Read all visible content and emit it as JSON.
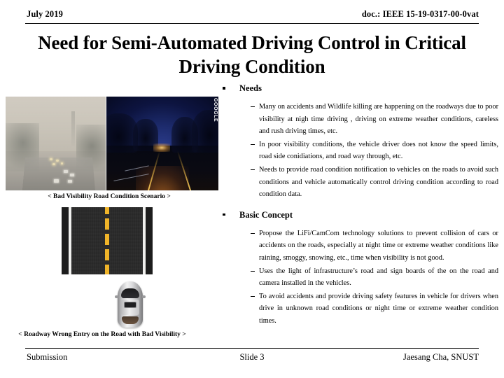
{
  "header": {
    "date": "July 2019",
    "doc": "doc.: IEEE 15-19-0317-00-0vat"
  },
  "title": "Need for Semi-Automated Driving Control in Critical Driving Condition",
  "media": {
    "fog_photo_alt": "foggy-highway-photo",
    "night_photo_alt": "night-road-photo",
    "night_photo_watermark": "GOOGLE",
    "road_photo_alt": "top-down-asphalt-road",
    "car_photo_alt": "top-down-silver-car",
    "caption_top": "< Bad Visibility Road Condition Scenario >",
    "caption_bottom": "< Roadway Wrong Entry on the Road with Bad Visibility >"
  },
  "content": {
    "sections": [
      {
        "heading": "Needs",
        "bullets": [
          "Many on accidents and  Wildlife killing are happening on the roadways due to poor visibility at nigh time driving , driving on extreme weather conditions, careless and rush driving times, etc.",
          "In poor visibility conditions, the vehicle driver does not know the speed limits, road side conidiations, and road way through, etc.",
          "Needs to provide road condition notification to vehicles on the roads to avoid such conditions and vehicle automatically control driving condition according to road condition data."
        ]
      },
      {
        "heading": "Basic Concept",
        "bullets": [
          "Propose the LiFi/CamCom technology solutions to prevent collision of cars or accidents on the roads, especially at night time or extreme weather conditions like raining, smoggy, snowing, etc., time when visibility is not good.",
          "Uses the light of infrastructure’s road and sign boards of the on the road and camera installed in the vehicles.",
          "To avoid accidents and provide driving safety features in vehicle for drivers when drive in unknown road conditions or night time or extreme weather condition times."
        ]
      }
    ]
  },
  "footer": {
    "left": "Submission",
    "center": "Slide 3",
    "right": "Jaesang Cha, SNUST"
  },
  "colors": {
    "text": "#000000",
    "background": "#ffffff",
    "road_line_yellow": "#f0b429",
    "night_sky_blue": "#1c2a6b"
  }
}
